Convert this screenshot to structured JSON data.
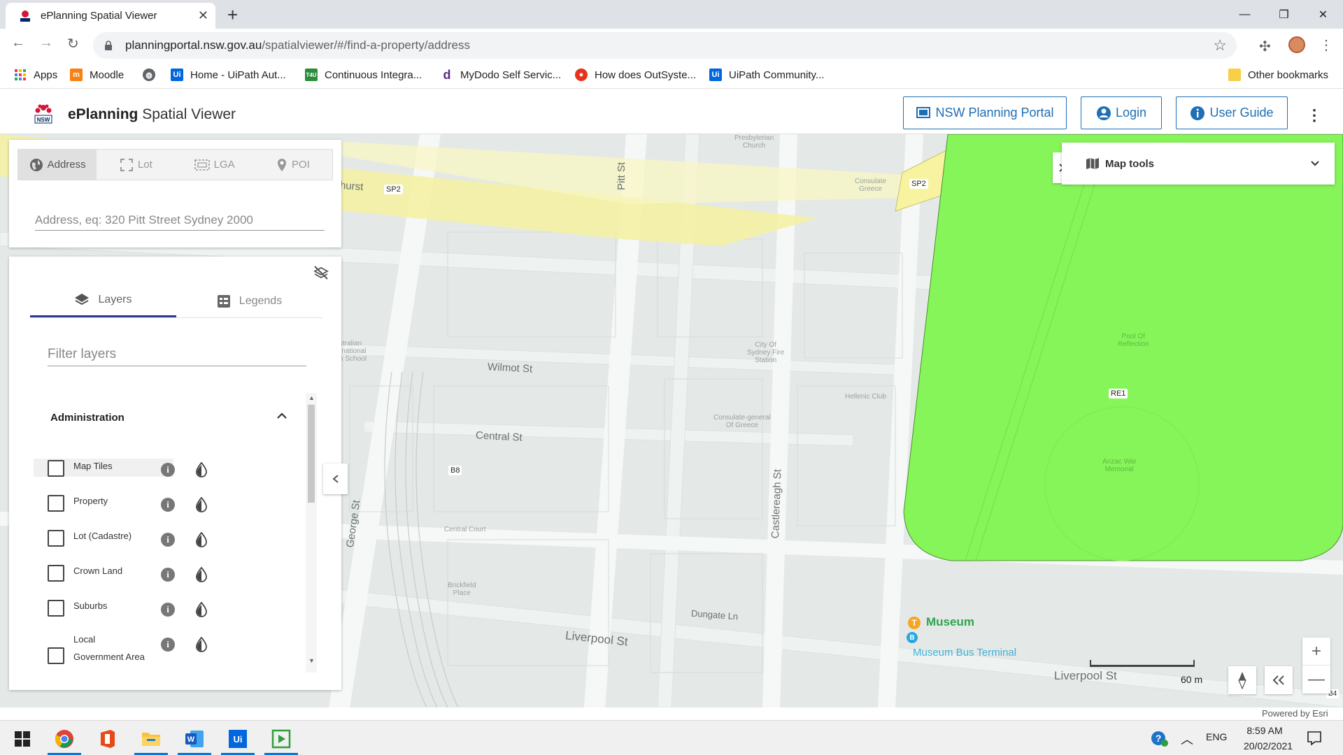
{
  "browser": {
    "tab_title": "ePlanning Spatial Viewer",
    "tab_close": "✕",
    "new_tab": "+",
    "url_domain": "planningportal.nsw.gov.au",
    "url_path": "/spatialviewer/#/find-a-property/address",
    "window_controls": {
      "minimize": "—",
      "maximize": "❐",
      "close": "✕"
    }
  },
  "bookmarks": [
    {
      "label": "Apps",
      "icon": "apps-grid-icon",
      "color": "#e94235"
    },
    {
      "label": "Moodle",
      "icon": "moodle-icon",
      "color": "#f98012"
    },
    {
      "label": "",
      "icon": "globe-icon",
      "color": "#5f6368"
    },
    {
      "label": "Home - UiPath Aut...",
      "icon": "uipath-icon",
      "color": "#0067df"
    },
    {
      "label": "Continuous Integra...",
      "icon": "t4u-icon",
      "color": "#2c8c3c"
    },
    {
      "label": "MyDodo Self Servic...",
      "icon": "dodo-icon",
      "color": "#5a2d82"
    },
    {
      "label": "How does OutSyste...",
      "icon": "outsystems-icon",
      "color": "#e8331b"
    },
    {
      "label": "UiPath Community...",
      "icon": "uipath-icon",
      "color": "#0067df"
    },
    {
      "label": "Other bookmarks",
      "icon": "folder-icon",
      "color": "#f9cf48"
    }
  ],
  "header": {
    "title_bold": "ePlanning",
    "title_rest": " Spatial Viewer",
    "buttons": {
      "portal": "NSW Planning Portal",
      "login": "Login",
      "guide": "User Guide"
    },
    "accent": "#1e6fb5"
  },
  "search": {
    "tabs": [
      "Address",
      "Lot",
      "LGA",
      "POI"
    ],
    "active_tab": "Address",
    "placeholder": "Address, eq: 320 Pitt Street Sydney 2000"
  },
  "layers_panel": {
    "tabs": [
      "Layers",
      "Legends"
    ],
    "active_tab": "Layers",
    "filter_placeholder": "Filter layers",
    "section": "Administration",
    "layers": [
      {
        "name": "Map Tiles",
        "checked": false
      },
      {
        "name": "Property",
        "checked": false
      },
      {
        "name": "Lot (Cadastre)",
        "checked": false
      },
      {
        "name": "Crown Land",
        "checked": false
      },
      {
        "name": "Suburbs",
        "checked": false
      },
      {
        "name": "Local\nGovernment Area",
        "checked": false
      }
    ]
  },
  "map_tools": {
    "label": "Map tools"
  },
  "map": {
    "streets": {
      "pitt": "Pitt St",
      "wilmot": "Wilmot   St",
      "central": "Central   St",
      "george": "George St",
      "castlereagh": "Castlereagh St",
      "liverpool": "Liverpool   St",
      "liverpool2": "Liverpool   St",
      "dungate": "Dungate   Ln",
      "hurst": "hurst"
    },
    "pois": {
      "museum": "Museum",
      "bus": "Museum Bus Terminal",
      "church": "Presbyterian\nChurch",
      "consulate_top": "Consulate\nGreece",
      "school": "stralian\nrnational\nh School",
      "fire": "City Of\nSydney Fire\nStation",
      "consulate": "Consulate-general\nOf Greece",
      "hellenic": "Hellenic Club",
      "pool": "Pool Of\nReflection",
      "anzac": "Anzac War\nMemorial",
      "court": "Central Court",
      "brickfield": "Brickfield\nPlace"
    },
    "zones": [
      "SP2",
      "SP2",
      "RE1",
      "B8",
      "B4"
    ],
    "scale": "60 m",
    "powered_by": "Powered by Esri",
    "colors": {
      "park": "#86f559",
      "road_zone": "#f7f3a0",
      "land": "#e4e9e7"
    }
  },
  "taskbar": {
    "lang": "ENG",
    "time": "8:59 AM",
    "date": "20/02/2021"
  }
}
